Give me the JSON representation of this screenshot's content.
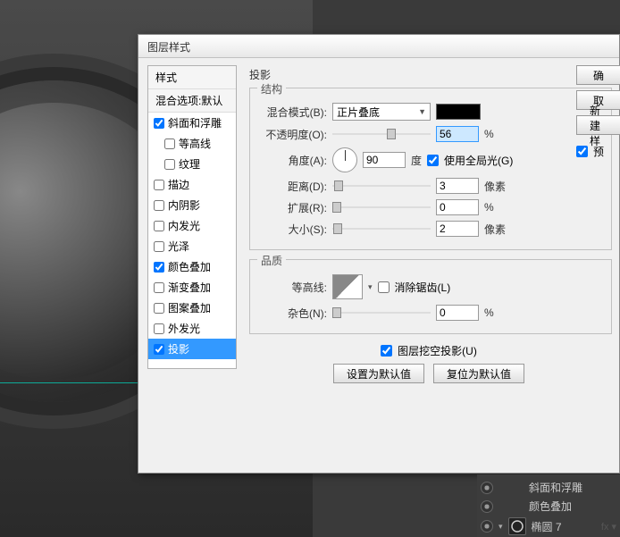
{
  "dialog": {
    "title": "图层样式",
    "stylesHeader": "样式",
    "blendDefault": "混合选项:默认",
    "effects": {
      "bevel": "斜面和浮雕",
      "contour": "等高线",
      "texture": "纹理",
      "stroke": "描边",
      "innerShadow": "内阴影",
      "innerGlow": "内发光",
      "satin": "光泽",
      "colorOverlay": "颜色叠加",
      "gradientOverlay": "渐变叠加",
      "patternOverlay": "图案叠加",
      "outerGlow": "外发光",
      "dropShadow": "投影"
    },
    "sectionTitle": "投影",
    "structure": {
      "legend": "结构",
      "blendModeLabel": "混合模式(B):",
      "blendModeValue": "正片叠底",
      "opacityLabel": "不透明度(O):",
      "opacityValue": "56",
      "opacityUnit": "%",
      "angleLabel": "角度(A):",
      "angleValue": "90",
      "angleUnit": "度",
      "globalLight": "使用全局光(G)",
      "distanceLabel": "距离(D):",
      "distanceValue": "3",
      "distanceUnit": "像素",
      "spreadLabel": "扩展(R):",
      "spreadValue": "0",
      "spreadUnit": "%",
      "sizeLabel": "大小(S):",
      "sizeValue": "2",
      "sizeUnit": "像素"
    },
    "quality": {
      "legend": "品质",
      "contourLabel": "等高线:",
      "antiAlias": "消除锯齿(L)",
      "noiseLabel": "杂色(N):",
      "noiseValue": "0",
      "noiseUnit": "%"
    },
    "knockout": "图层挖空投影(U)",
    "setDefault": "设置为默认值",
    "resetDefault": "复位为默认值",
    "buttons": {
      "ok": "确",
      "cancel": "取",
      "newStyle": "新建样",
      "preview": "预"
    }
  },
  "layers": {
    "fx1": "斜面和浮雕",
    "fx2": "颜色叠加",
    "layerName": "椭圆 7"
  }
}
